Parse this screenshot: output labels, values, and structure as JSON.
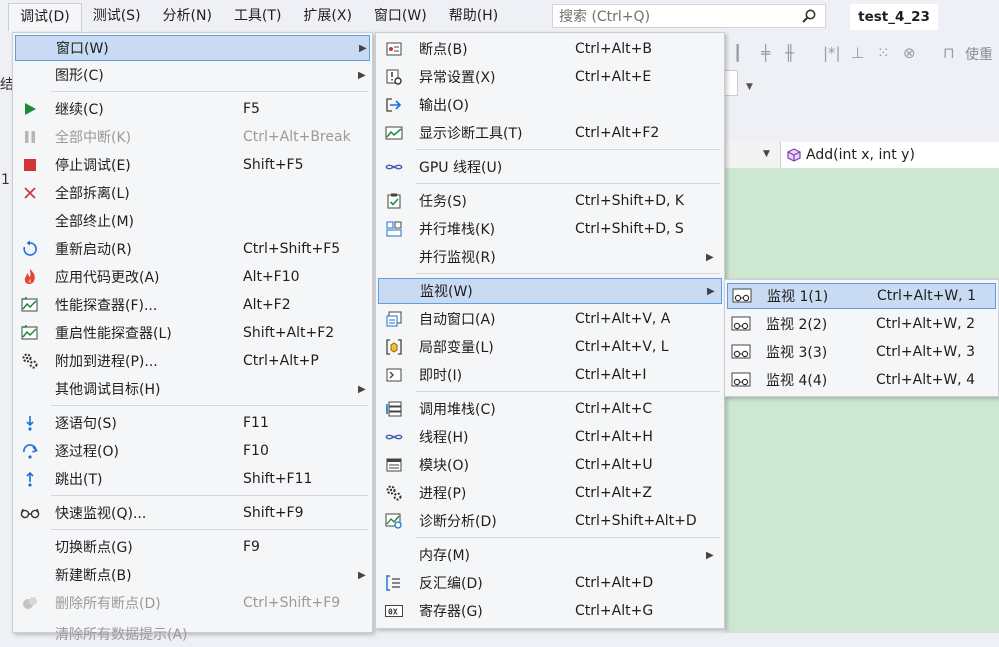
{
  "menubar": {
    "items": [
      "调试(D)",
      "测试(S)",
      "分析(N)",
      "工具(T)",
      "扩展(X)",
      "窗口(W)",
      "帮助(H)"
    ],
    "search_placeholder": "搜索 (Ctrl+Q)",
    "solution_title": "test_4_23"
  },
  "background": {
    "left_chars": [
      "结",
      "1"
    ],
    "function_box": "Add(int x, int y)",
    "toolbar_text": "使重"
  },
  "debug_menu": {
    "items": [
      {
        "label": "窗口(W)",
        "shortcut": "",
        "icon": "",
        "submenu": true,
        "highlighted": true
      },
      {
        "label": "图形(C)",
        "shortcut": "",
        "icon": "",
        "submenu": true
      },
      {
        "label": "继续(C)",
        "shortcut": "F5",
        "icon": "play-icon"
      },
      {
        "label": "全部中断(K)",
        "shortcut": "Ctrl+Alt+Break",
        "icon": "pause-icon",
        "disabled": true
      },
      {
        "label": "停止调试(E)",
        "shortcut": "Shift+F5",
        "icon": "stop-icon"
      },
      {
        "label": "全部拆离(L)",
        "shortcut": "",
        "icon": "detach-icon"
      },
      {
        "label": "全部终止(M)",
        "shortcut": "",
        "icon": ""
      },
      {
        "label": "重新启动(R)",
        "shortcut": "Ctrl+Shift+F5",
        "icon": "restart-icon"
      },
      {
        "label": "应用代码更改(A)",
        "shortcut": "Alt+F10",
        "icon": "hot-reload-icon"
      },
      {
        "label": "性能探查器(F)...",
        "shortcut": "Alt+F2",
        "icon": "profiler-icon"
      },
      {
        "label": "重启性能探查器(L)",
        "shortcut": "Shift+Alt+F2",
        "icon": "profiler-icon"
      },
      {
        "label": "附加到进程(P)...",
        "shortcut": "Ctrl+Alt+P",
        "icon": "gears-icon"
      },
      {
        "label": "其他调试目标(H)",
        "shortcut": "",
        "icon": "",
        "submenu": true
      },
      {
        "label": "逐语句(S)",
        "shortcut": "F11",
        "icon": "step-into-icon"
      },
      {
        "label": "逐过程(O)",
        "shortcut": "F10",
        "icon": "step-over-icon"
      },
      {
        "label": "跳出(T)",
        "shortcut": "Shift+F11",
        "icon": "step-out-icon"
      },
      {
        "label": "快速监视(Q)...",
        "shortcut": "Shift+F9",
        "icon": "glasses-icon"
      },
      {
        "label": "切换断点(G)",
        "shortcut": "F9",
        "icon": ""
      },
      {
        "label": "新建断点(B)",
        "shortcut": "",
        "icon": "",
        "submenu": true
      },
      {
        "label": "删除所有断点(D)",
        "shortcut": "Ctrl+Shift+F9",
        "icon": "delete-breakpoints-icon",
        "disabled": true
      },
      {
        "label": "清除所有数据提示(A)",
        "shortcut": "",
        "icon": "",
        "disabled": true
      }
    ]
  },
  "window_menu": {
    "items": [
      {
        "label": "断点(B)",
        "shortcut": "Ctrl+Alt+B",
        "icon": "breakpoints-window-icon"
      },
      {
        "label": "异常设置(X)",
        "shortcut": "Ctrl+Alt+E",
        "icon": "exception-settings-icon"
      },
      {
        "label": "输出(O)",
        "shortcut": "",
        "icon": "output-icon"
      },
      {
        "label": "显示诊断工具(T)",
        "shortcut": "Ctrl+Alt+F2",
        "icon": "diagnostic-tools-icon"
      },
      {
        "label": "GPU 线程(U)",
        "shortcut": "",
        "icon": "gpu-threads-icon"
      },
      {
        "label": "任务(S)",
        "shortcut": "Ctrl+Shift+D, K",
        "icon": "tasks-icon"
      },
      {
        "label": "并行堆栈(K)",
        "shortcut": "Ctrl+Shift+D, S",
        "icon": "parallel-stacks-icon"
      },
      {
        "label": "并行监视(R)",
        "shortcut": "",
        "icon": "",
        "submenu": true
      },
      {
        "label": "监视(W)",
        "shortcut": "",
        "icon": "",
        "submenu": true,
        "highlighted": true
      },
      {
        "label": "自动窗口(A)",
        "shortcut": "Ctrl+Alt+V, A",
        "icon": "autos-icon"
      },
      {
        "label": "局部变量(L)",
        "shortcut": "Ctrl+Alt+V, L",
        "icon": "locals-icon"
      },
      {
        "label": "即时(I)",
        "shortcut": "Ctrl+Alt+I",
        "icon": "immediate-icon"
      },
      {
        "label": "调用堆栈(C)",
        "shortcut": "Ctrl+Alt+C",
        "icon": "call-stack-icon"
      },
      {
        "label": "线程(H)",
        "shortcut": "Ctrl+Alt+H",
        "icon": "threads-icon"
      },
      {
        "label": "模块(O)",
        "shortcut": "Ctrl+Alt+U",
        "icon": "modules-icon"
      },
      {
        "label": "进程(P)",
        "shortcut": "Ctrl+Alt+Z",
        "icon": "processes-icon"
      },
      {
        "label": "诊断分析(D)",
        "shortcut": "Ctrl+Shift+Alt+D",
        "icon": "diagnostic-analysis-icon"
      },
      {
        "label": "内存(M)",
        "shortcut": "",
        "icon": "",
        "submenu": true
      },
      {
        "label": "反汇编(D)",
        "shortcut": "Ctrl+Alt+D",
        "icon": "disassembly-icon"
      },
      {
        "label": "寄存器(G)",
        "shortcut": "Ctrl+Alt+G",
        "icon": "registers-icon"
      }
    ]
  },
  "watch_menu": {
    "items": [
      {
        "label": "监视 1(1)",
        "shortcut": "Ctrl+Alt+W, 1",
        "icon": "watch-icon",
        "highlighted": true
      },
      {
        "label": "监视 2(2)",
        "shortcut": "Ctrl+Alt+W, 2",
        "icon": "watch-icon"
      },
      {
        "label": "监视 3(3)",
        "shortcut": "Ctrl+Alt+W, 3",
        "icon": "watch-icon"
      },
      {
        "label": "监视 4(4)",
        "shortcut": "Ctrl+Alt+W, 4",
        "icon": "watch-icon"
      }
    ]
  }
}
